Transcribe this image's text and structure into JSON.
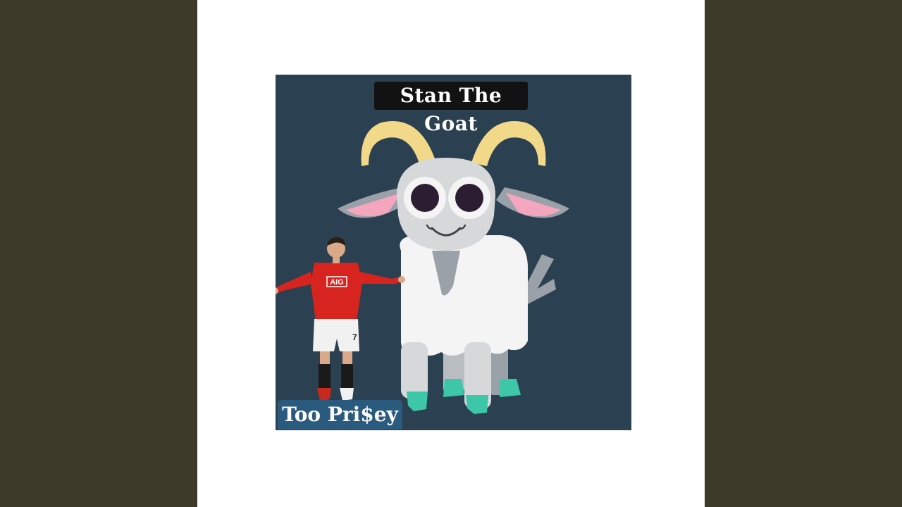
{
  "cover": {
    "title": "Stan The Goat",
    "artist": "Too Pri$ey",
    "jersey_sponsor": "AIG",
    "jersey_number": "7"
  },
  "colors": {
    "background_side": "#3e3a2a",
    "cover_background": "#2b4050",
    "horns": "#f2d98a",
    "goat_body": "#f4f4f4",
    "goat_head": "#d7d8da",
    "ears_inner": "#f3a6bd",
    "hooves": "#3ec6a8",
    "jersey": "#d8241f"
  },
  "icons": {
    "goat": "goat-illustration",
    "player": "footballer-figure"
  }
}
